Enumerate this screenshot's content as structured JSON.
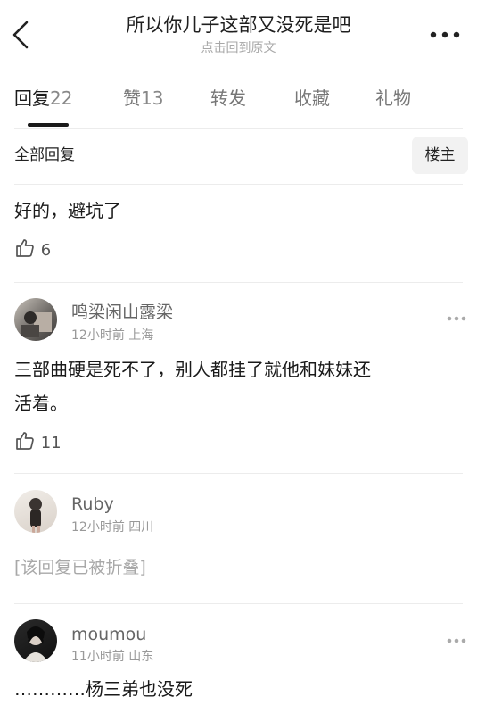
{
  "header": {
    "title": "所以你儿子这部又没死是吧",
    "subtitle": "点击回到原文",
    "back_icon": "chevron-left-icon",
    "more_icon": "more-horizontal-icon"
  },
  "tabs": [
    {
      "label": "回复",
      "count": "22",
      "active": true
    },
    {
      "label": "赞",
      "count": "13",
      "active": false
    },
    {
      "label": "转发",
      "count": "",
      "active": false
    },
    {
      "label": "收藏",
      "count": "",
      "active": false
    },
    {
      "label": "礼物",
      "count": "",
      "active": false
    }
  ],
  "filter": {
    "label": "全部回复",
    "owner_button": "楼主"
  },
  "comments": [
    {
      "text": "好的，避坑了",
      "likes": "6"
    },
    {
      "username": "鸣梁闲山露梁",
      "time": "12小时前",
      "location": "上海",
      "text_line1": "三部曲硬是死不了，别人都挂了就他和妹妹还",
      "text_line2": "活着。",
      "likes": "11"
    },
    {
      "username": "Ruby",
      "time": "12小时前",
      "location": "四川",
      "folded_text": "[该回复已被折叠]"
    },
    {
      "username": "moumou",
      "time": "11小时前",
      "location": "山东",
      "text": "…………杨三弟也没死"
    }
  ],
  "colors": {
    "text_primary": "#1a1a1a",
    "text_secondary": "#999999",
    "divider": "#ececec"
  }
}
